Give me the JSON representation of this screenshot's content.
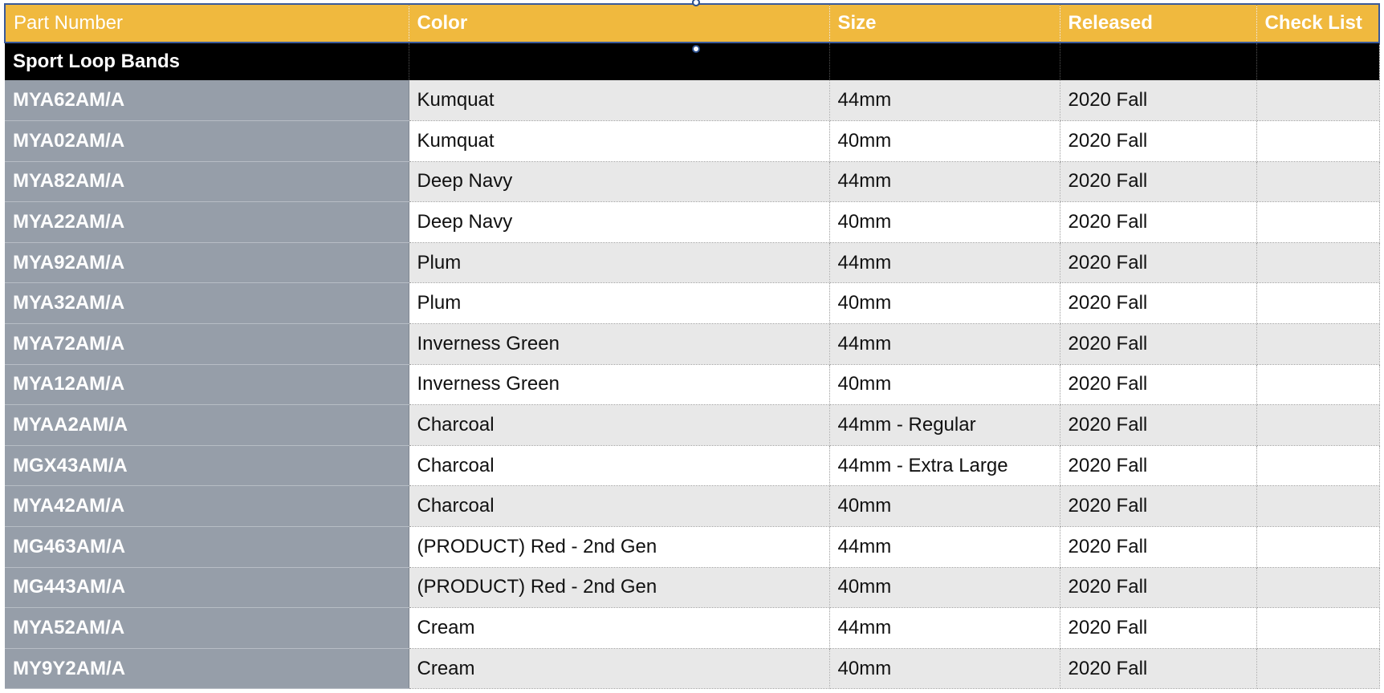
{
  "table": {
    "headers": [
      "Part Number",
      "Color",
      "Size",
      "Released",
      "Check List"
    ],
    "group_label": "Sport Loop Bands",
    "rows": [
      {
        "part": "MYA62AM/A",
        "color": "Kumquat",
        "size": "44mm",
        "released": "2020 Fall",
        "check": ""
      },
      {
        "part": "MYA02AM/A",
        "color": "Kumquat",
        "size": "40mm",
        "released": "2020 Fall",
        "check": ""
      },
      {
        "part": "MYA82AM/A",
        "color": "Deep Navy",
        "size": "44mm",
        "released": "2020 Fall",
        "check": ""
      },
      {
        "part": "MYA22AM/A",
        "color": "Deep Navy",
        "size": "40mm",
        "released": "2020 Fall",
        "check": ""
      },
      {
        "part": "MYA92AM/A",
        "color": "Plum",
        "size": "44mm",
        "released": "2020 Fall",
        "check": ""
      },
      {
        "part": "MYA32AM/A",
        "color": "Plum",
        "size": "40mm",
        "released": "2020 Fall",
        "check": ""
      },
      {
        "part": "MYA72AM/A",
        "color": "Inverness Green",
        "size": "44mm",
        "released": "2020 Fall",
        "check": ""
      },
      {
        "part": "MYA12AM/A",
        "color": "Inverness Green",
        "size": "40mm",
        "released": "2020 Fall",
        "check": ""
      },
      {
        "part": "MYAA2AM/A",
        "color": "Charcoal",
        "size": "44mm - Regular",
        "released": "2020 Fall",
        "check": ""
      },
      {
        "part": "MGX43AM/A",
        "color": "Charcoal",
        "size": "44mm - Extra Large",
        "released": "2020 Fall",
        "check": ""
      },
      {
        "part": "MYA42AM/A",
        "color": "Charcoal",
        "size": "40mm",
        "released": "2020 Fall",
        "check": ""
      },
      {
        "part": "MG463AM/A",
        "color": "(PRODUCT) Red - 2nd Gen",
        "size": "44mm",
        "released": "2020 Fall",
        "check": ""
      },
      {
        "part": "MG443AM/A",
        "color": "(PRODUCT) Red - 2nd Gen",
        "size": "40mm",
        "released": "2020 Fall",
        "check": ""
      },
      {
        "part": "MYA52AM/A",
        "color": "Cream",
        "size": "44mm",
        "released": "2020 Fall",
        "check": ""
      },
      {
        "part": "MY9Y2AM/A",
        "color": "Cream",
        "size": "40mm",
        "released": "2020 Fall",
        "check": ""
      }
    ]
  },
  "colors": {
    "header_bg": "#f0b93e",
    "header_text": "#ffffff",
    "group_bg": "#000000",
    "part_col_bg": "#969ea9",
    "row_shaded": "#e8e8e8",
    "row_plain": "#ffffff",
    "selection": "#2b4f8c"
  }
}
